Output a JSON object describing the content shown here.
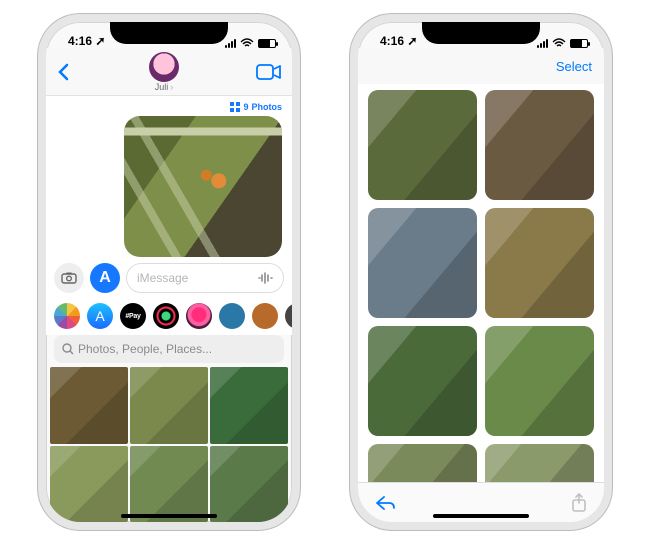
{
  "statusbar": {
    "time": "4:16",
    "arrow": "➚"
  },
  "phone1": {
    "nav": {
      "contact_name": "Juli"
    },
    "photos_link": {
      "count": "9",
      "label": "Photos"
    },
    "composer": {
      "placeholder": "iMessage"
    },
    "apps": {
      "pay_label": "#Pay"
    },
    "search": {
      "placeholder": "Photos, People, Places..."
    }
  },
  "phone2": {
    "select_label": "Select"
  }
}
